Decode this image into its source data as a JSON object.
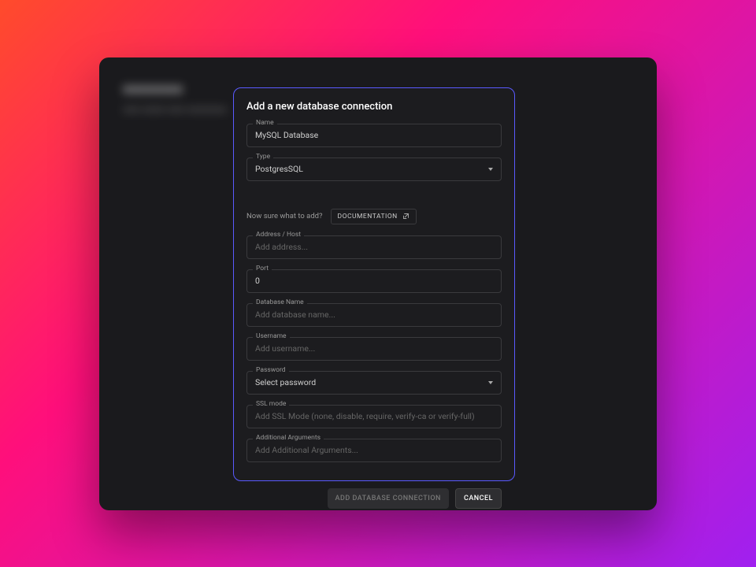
{
  "modal": {
    "title": "Add a new database connection",
    "fields": {
      "name": {
        "label": "Name",
        "value": "MySQL Database"
      },
      "type": {
        "label": "Type",
        "value": "PostgresSQL"
      },
      "address": {
        "label": "Address / Host",
        "placeholder": "Add address..."
      },
      "port": {
        "label": "Port",
        "value": "0"
      },
      "dbname": {
        "label": "Database Name",
        "placeholder": "Add database name..."
      },
      "username": {
        "label": "Username",
        "placeholder": "Add username..."
      },
      "password": {
        "label": "Password",
        "value": "Select password"
      },
      "sslmode": {
        "label": "SSL mode",
        "placeholder": "Add SSL Mode (none, disable, require, verify-ca or verify-full)"
      },
      "additional": {
        "label": "Additional Arguments",
        "placeholder": "Add Additional Arguments..."
      }
    },
    "help": {
      "text": "Now sure what to add?",
      "docLabel": "DOCUMENTATION"
    },
    "buttons": {
      "primary": "ADD DATABASE CONNECTION",
      "cancel": "CANCEL"
    }
  }
}
